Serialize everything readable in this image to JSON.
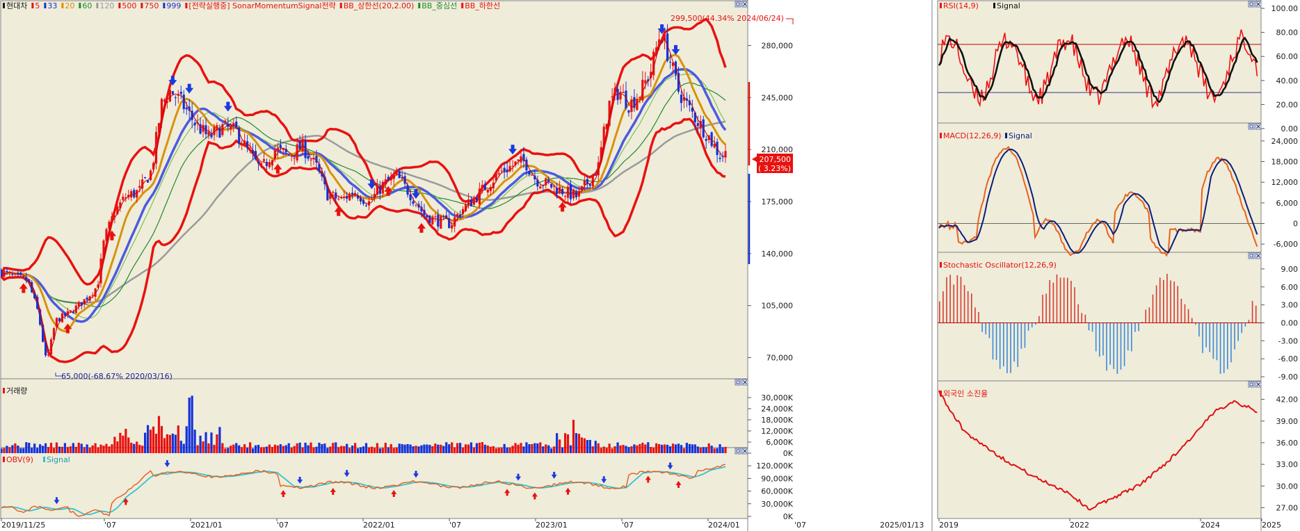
{
  "colors": {
    "bg": "#efecda",
    "axis_bg": "#ffffff",
    "red": "#e8120f",
    "blue": "#1432d8",
    "orange": "#e07a00",
    "green": "#1f8b2a",
    "gray": "#9a9a9a",
    "lightgreen": "#5fbf3a",
    "navy": "#0a1e7a",
    "darkblue": "#2a3cd0",
    "cyan": "#2fc4d0"
  },
  "main": {
    "legend": [
      {
        "text": "현대차",
        "color": "#1a1a1a"
      },
      {
        "text": "5",
        "color": "#e8120f"
      },
      {
        "text": "33",
        "color": "#1432d8"
      },
      {
        "text": "20",
        "color": "#e08a00"
      },
      {
        "text": "60",
        "color": "#1f8b2a"
      },
      {
        "text": "120",
        "color": "#9a9a9a"
      },
      {
        "text": "500",
        "color": "#e8120f"
      },
      {
        "text": "750",
        "color": "#e8120f"
      },
      {
        "text": "999",
        "color": "#1432d8"
      },
      {
        "text": "[전략실행중] SonarMomentumSignal전략",
        "color": "#e8120f"
      },
      {
        "text": "BB_상한선(20,2.00)",
        "color": "#e8120f"
      },
      {
        "text": "BB_중심선",
        "color": "#1f8b2a"
      },
      {
        "text": "BB_하한선",
        "color": "#e8120f"
      }
    ],
    "high_annotation": "299,500(44.34% 2024/06/24)",
    "low_annotation": "65,000(-68.67% 2020/03/16)",
    "last_price": "207,500",
    "last_change": "3.23%"
  },
  "volume": {
    "title": "거래량"
  },
  "obv": {
    "title_a": "OBV(9)",
    "title_b": "Signal"
  },
  "rsi": {
    "title_a": "RSI(14,9)",
    "title_b": "Signal"
  },
  "macd": {
    "title_a": "MACD(12,26,9)",
    "title_b": "Signal"
  },
  "stoch": {
    "title": "Stochastic Oscillator(12,26,9)"
  },
  "foreign": {
    "title": "외국인 소진율"
  },
  "chart_data": [
    {
      "type": "candlestick",
      "title": "현대차",
      "x_tick_labels": [
        "2019/11/25",
        "'07",
        "2021/01",
        "'07",
        "2022/01",
        "'07",
        "2023/01",
        "'07",
        "2024/01",
        "'07",
        "2025/01/13"
      ],
      "y_ticks": [
        70000,
        105000,
        140000,
        175000,
        210000,
        245000,
        280000
      ],
      "y_tick_labels": [
        "70,000",
        "105,000",
        "140,000",
        "175,000",
        "210,000",
        "245,000",
        "280,000"
      ],
      "ylim": [
        52000,
        305000
      ],
      "annotations": [
        "299,500(44.34% 2024/06/24)",
        "65,000(-68.67% 2020/03/16)"
      ],
      "close_points": [
        [
          0,
          128000
        ],
        [
          20,
          124000
        ],
        [
          40,
          122000
        ],
        [
          55,
          100000
        ],
        [
          67,
          66000
        ],
        [
          80,
          95000
        ],
        [
          100,
          100000
        ],
        [
          120,
          108000
        ],
        [
          140,
          118000
        ],
        [
          150,
          150000
        ],
        [
          165,
          168000
        ],
        [
          180,
          178000
        ],
        [
          200,
          182000
        ],
        [
          218,
          196000
        ],
        [
          232,
          240000
        ],
        [
          245,
          250000
        ],
        [
          260,
          242000
        ],
        [
          280,
          228000
        ],
        [
          300,
          218000
        ],
        [
          320,
          225000
        ],
        [
          340,
          222000
        ],
        [
          355,
          210000
        ],
        [
          375,
          196000
        ],
        [
          395,
          210000
        ],
        [
          415,
          206000
        ],
        [
          435,
          212000
        ],
        [
          455,
          198000
        ],
        [
          470,
          180000
        ],
        [
          490,
          176000
        ],
        [
          510,
          182000
        ],
        [
          530,
          174000
        ],
        [
          550,
          186000
        ],
        [
          570,
          192000
        ],
        [
          590,
          180000
        ],
        [
          610,
          166000
        ],
        [
          630,
          162000
        ],
        [
          648,
          160000
        ],
        [
          665,
          170000
        ],
        [
          680,
          176000
        ],
        [
          700,
          186000
        ],
        [
          720,
          195000
        ],
        [
          740,
          200000
        ],
        [
          755,
          202000
        ],
        [
          770,
          190000
        ],
        [
          790,
          186000
        ],
        [
          810,
          182000
        ],
        [
          830,
          178000
        ],
        [
          845,
          188000
        ],
        [
          860,
          198000
        ],
        [
          875,
          240000
        ],
        [
          890,
          250000
        ],
        [
          905,
          240000
        ],
        [
          920,
          248000
        ],
        [
          935,
          262000
        ],
        [
          950,
          290000
        ],
        [
          962,
          272000
        ],
        [
          975,
          250000
        ],
        [
          990,
          238000
        ],
        [
          1005,
          228000
        ],
        [
          1020,
          218000
        ],
        [
          1035,
          206000
        ],
        [
          1045,
          207500
        ]
      ],
      "ma": [
        {
          "name": "5",
          "color": "#e8120f"
        },
        {
          "name": "33",
          "color": "#1432d8"
        },
        {
          "name": "20",
          "color": "#e08a00"
        },
        {
          "name": "60",
          "color": "#1f8b2a"
        },
        {
          "name": "120",
          "color": "#9a9a9a"
        }
      ],
      "bb": {
        "upper": "BB_상한선(20,2.00)",
        "middle": "BB_중심선",
        "lower": "BB_하한선"
      }
    },
    {
      "type": "bar",
      "title": "거래량",
      "y_tick_labels": [
        "30,000K",
        "24,000K",
        "18,000K",
        "12,000K",
        "6,000K",
        "0K"
      ]
    },
    {
      "type": "line",
      "title": "OBV(9)",
      "series": [
        {
          "name": "OBV(9)"
        },
        {
          "name": "Signal"
        }
      ],
      "y_tick_labels": [
        "120,000K",
        "90,000K",
        "60,000K",
        "30,000K",
        "0K"
      ]
    },
    {
      "type": "line",
      "title": "RSI(14,9)",
      "series": [
        {
          "name": "RSI(14,9)"
        },
        {
          "name": "Signal"
        }
      ],
      "y_tick_labels": [
        "100.00",
        "80.00",
        "60.00",
        "40.00",
        "20.00",
        "0.00"
      ],
      "ylim": [
        0,
        100
      ],
      "guide_lines": [
        70,
        30
      ]
    },
    {
      "type": "line",
      "title": "MACD(12,26,9)",
      "series": [
        {
          "name": "MACD(12,26,9)"
        },
        {
          "name": "Signal"
        }
      ],
      "y_tick_labels": [
        "24,000",
        "18,000",
        "12,000",
        "6,000",
        "0",
        "-6,000"
      ],
      "ylim": [
        -10000,
        27000
      ]
    },
    {
      "type": "bar",
      "title": "Stochastic Oscillator(12,26,9)",
      "y_tick_labels": [
        "9.00",
        "6.00",
        "3.00",
        "0.00",
        "-3.00",
        "-6.00",
        "-9.00"
      ],
      "ylim": [
        -10.5,
        10.5
      ]
    },
    {
      "type": "line",
      "title": "외국인 소진율",
      "y_tick_labels": [
        "42.00",
        "39.00",
        "36.00",
        "33.00",
        "30.00",
        "27.00"
      ],
      "ylim": [
        25.5,
        43.5
      ],
      "x_tick_labels": [
        "2019",
        "2022",
        "2024",
        "2025"
      ]
    }
  ]
}
